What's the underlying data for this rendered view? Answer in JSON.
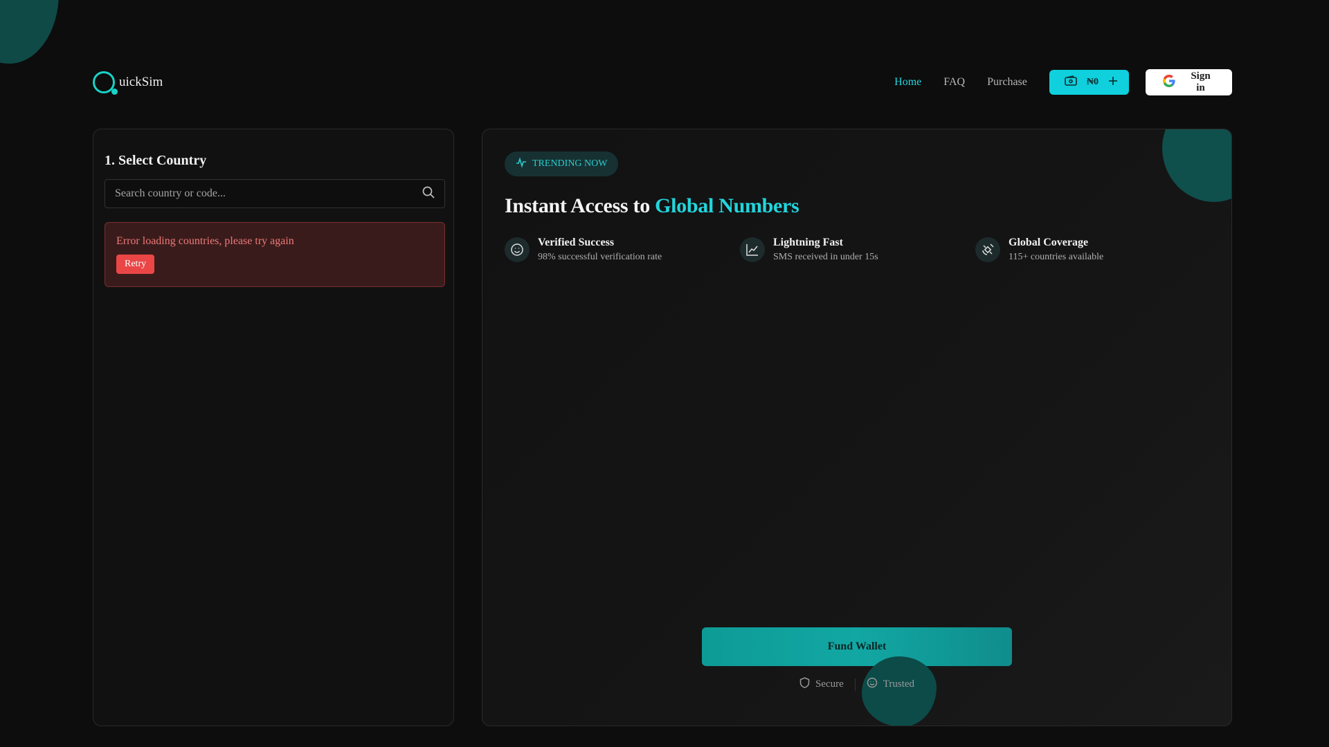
{
  "brand": {
    "logo_text": "uickSim"
  },
  "nav": {
    "items": [
      {
        "label": "Home",
        "active": true
      },
      {
        "label": "FAQ",
        "active": false
      },
      {
        "label": "Purchase",
        "active": false
      }
    ],
    "wallet_balance": "₦0",
    "sign_in_label": "Sign in"
  },
  "country_panel": {
    "title": "1. Select Country",
    "search_placeholder": "Search country or code...",
    "error_message": "Error loading countries, please try again",
    "retry_label": "Retry"
  },
  "hero": {
    "badge": "TRENDING NOW",
    "headline_prefix": "Instant Access to ",
    "headline_accent": "Global Numbers",
    "features": [
      {
        "icon": "smile-icon",
        "title": "Verified Success",
        "desc": "98% successful verification rate"
      },
      {
        "icon": "chart-line-icon",
        "title": "Lightning Fast",
        "desc": "SMS received in under 15s"
      },
      {
        "icon": "satellite-icon",
        "title": "Global Coverage",
        "desc": "115+ countries available"
      }
    ],
    "fund_button": "Fund Wallet",
    "badges": [
      {
        "icon": "shield-icon",
        "label": "Secure"
      },
      {
        "icon": "smile-icon",
        "label": "Trusted"
      }
    ]
  },
  "colors": {
    "accent": "#18d3c8",
    "background": "#0d0d0d",
    "error": "#ea4646",
    "wallet_button": "#0fd0dc"
  }
}
